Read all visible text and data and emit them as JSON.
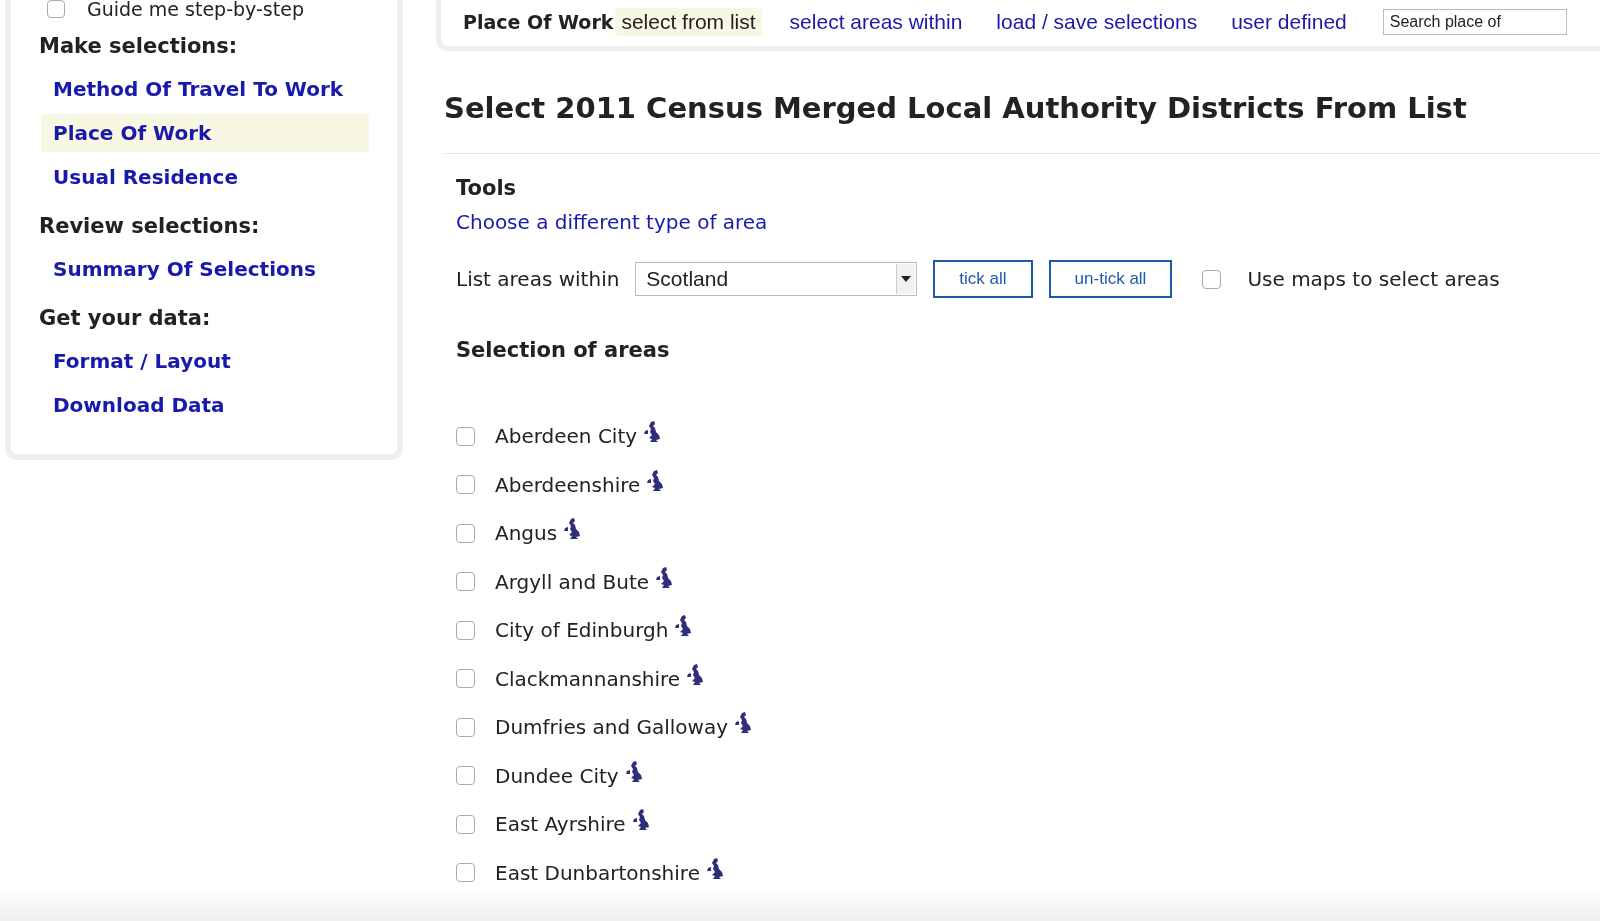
{
  "sidebar": {
    "guide": {
      "label": "Guide me step-by-step",
      "checked": false
    },
    "sections": [
      {
        "heading": "Make selections:",
        "items": [
          {
            "label": "Method Of Travel To Work",
            "selected": false
          },
          {
            "label": "Place Of Work",
            "selected": true
          },
          {
            "label": "Usual Residence",
            "selected": false
          }
        ]
      },
      {
        "heading": "Review selections:",
        "items": [
          {
            "label": "Summary Of Selections",
            "selected": false
          }
        ]
      },
      {
        "heading": "Get your data:",
        "items": [
          {
            "label": "Format / Layout",
            "selected": false
          },
          {
            "label": "Download Data",
            "selected": false
          }
        ]
      }
    ]
  },
  "topnav": {
    "title": "Place Of Work",
    "tabs": [
      {
        "label": "select from list",
        "selected": true
      },
      {
        "label": "select areas within",
        "selected": false
      },
      {
        "label": "load / save selections",
        "selected": false
      },
      {
        "label": "user defined",
        "selected": false
      }
    ],
    "search": {
      "placeholder": "Search place of"
    }
  },
  "heading": "Select 2011 Census Merged Local Authority Districts From List",
  "tools": {
    "heading": "Tools",
    "link": "Choose a different type of area"
  },
  "controls": {
    "label": "List areas within",
    "dropdown": "Scotland",
    "buttons": [
      "tick all",
      "un-tick all"
    ],
    "maps": {
      "label": "Use maps to select areas",
      "checked": false
    }
  },
  "selection": {
    "heading": "Selection of areas",
    "areas": [
      {
        "name": "Aberdeen City",
        "checked": false
      },
      {
        "name": "Aberdeenshire",
        "checked": false
      },
      {
        "name": "Angus",
        "checked": false
      },
      {
        "name": "Argyll and Bute",
        "checked": false
      },
      {
        "name": "City of Edinburgh",
        "checked": false
      },
      {
        "name": "Clackmannanshire",
        "checked": false
      },
      {
        "name": "Dumfries and Galloway",
        "checked": false
      },
      {
        "name": "Dundee City",
        "checked": false
      },
      {
        "name": "East Ayrshire",
        "checked": false
      },
      {
        "name": "East Dunbartonshire",
        "checked": false
      }
    ]
  }
}
